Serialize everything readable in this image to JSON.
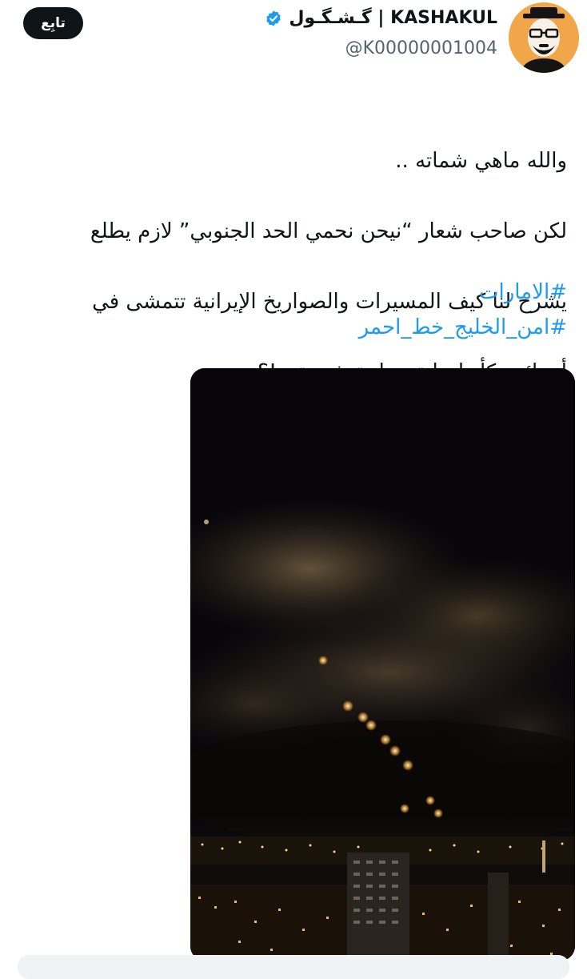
{
  "tweet": {
    "follow_label": "تابِع",
    "display_name": "گـشـگـول | KASHAKUL",
    "verified": true,
    "handle": "@K00000001004",
    "lines": [
      "والله ماهي شماته ..",
      "لكن صاحب شعار “نيحن نحمي الحد الجنوبي” لازم يطلع",
      "يشرح لنا كيف المسيرات والصواريخ الإيرانية تتمشى في",
      "أجوائهم كأنها جاية سياحة شتوية ..!؟"
    ],
    "hashtags": [
      "#الامارات",
      "#امن_الخليج_خط_احمر"
    ]
  },
  "colors": {
    "link": "#1d9bf0",
    "verified_badge": "#1d9bf0",
    "follow_button_bg": "#0f1419",
    "avatar_bg": "#f2a64a"
  },
  "icons": {
    "verified": "verified-badge-icon"
  }
}
